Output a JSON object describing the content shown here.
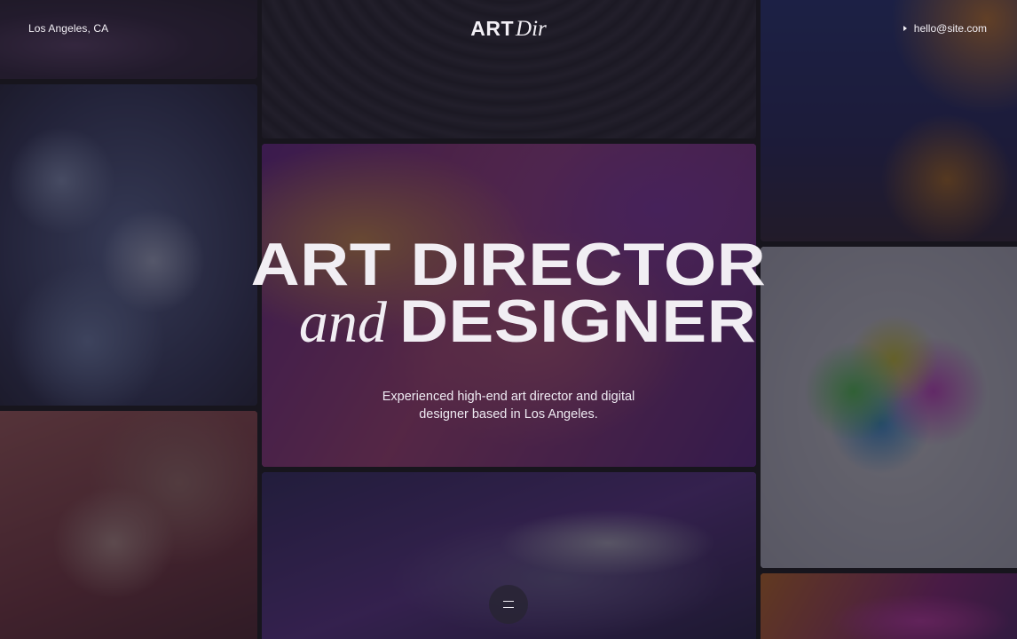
{
  "header": {
    "location": "Los Angeles, CA",
    "logo": {
      "bold": "ART",
      "italic": "Dir"
    },
    "contact_email": "hello@site.com",
    "contact_icon": "arrow-right-icon"
  },
  "hero": {
    "line1": "ART DIRECTOR",
    "line2_italic": "and",
    "line2_bold": "DESIGNER",
    "subtitle": "Experienced high-end art director and digital designer based in Los Angeles."
  },
  "menu": {
    "icon": "menu-icon"
  },
  "colors": {
    "background": "#17151d",
    "text": "#f1eef3"
  }
}
